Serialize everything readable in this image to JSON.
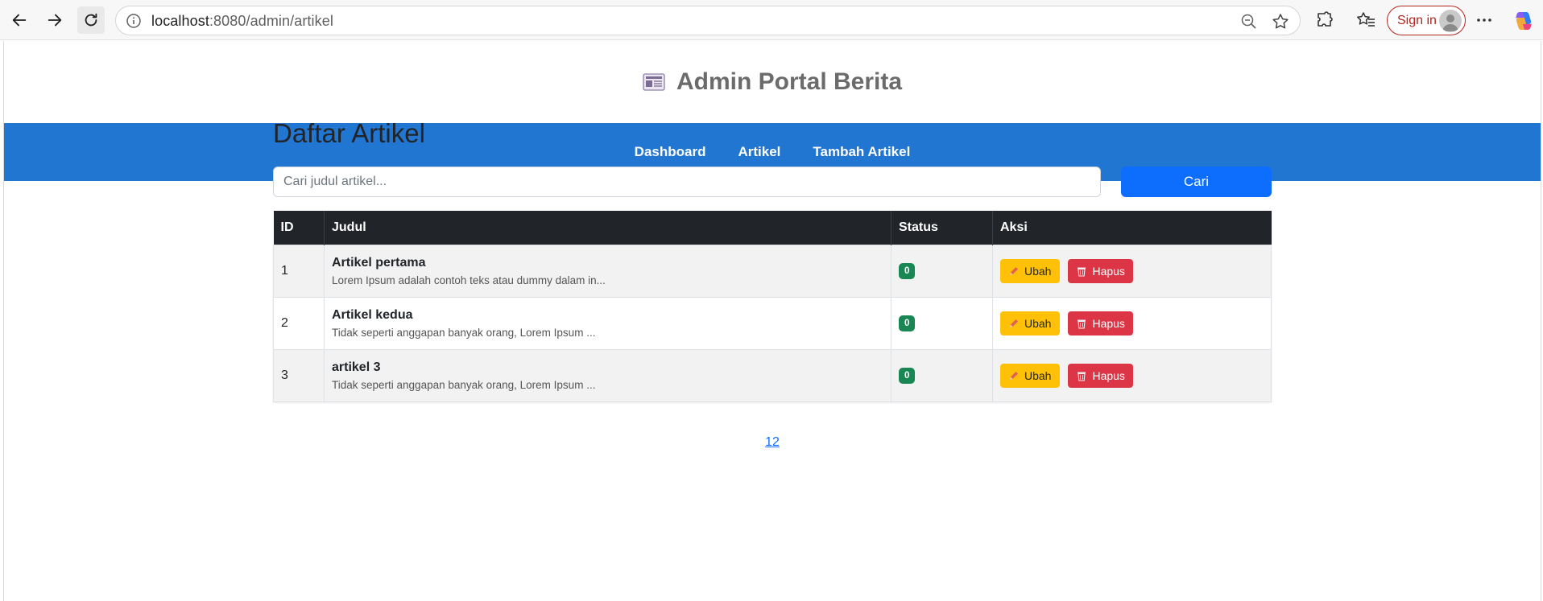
{
  "browser": {
    "url_host": "localhost",
    "url_rest": ":8080/admin/artikel",
    "signin_label": "Sign in"
  },
  "site": {
    "title": "Admin Portal Berita"
  },
  "nav": {
    "items": [
      {
        "label": "Dashboard"
      },
      {
        "label": "Artikel"
      },
      {
        "label": "Tambah Artikel"
      }
    ]
  },
  "main": {
    "heading": "Daftar Artikel",
    "search_placeholder": "Cari judul artikel...",
    "search_button": "Cari",
    "columns": [
      "ID",
      "Judul",
      "Status",
      "Aksi"
    ],
    "rows": [
      {
        "id": "1",
        "title": "Artikel pertama",
        "excerpt": "Lorem Ipsum adalah contoh teks atau dummy dalam in...",
        "status": "0",
        "edit": "Ubah",
        "delete": "Hapus"
      },
      {
        "id": "2",
        "title": "Artikel kedua",
        "excerpt": "Tidak seperti anggapan banyak orang, Lorem Ipsum ...",
        "status": "0",
        "edit": "Ubah",
        "delete": "Hapus"
      },
      {
        "id": "3",
        "title": "artikel 3",
        "excerpt": "Tidak seperti anggapan banyak orang, Lorem Ipsum ...",
        "status": "0",
        "edit": "Ubah",
        "delete": "Hapus"
      }
    ],
    "pagination": "12"
  },
  "colors": {
    "navbar": "#2176d2",
    "primary": "#0d6efd",
    "warning": "#ffc107",
    "danger": "#dc3545",
    "success": "#198754",
    "table_header": "#212529"
  },
  "icons": {
    "back": "arrow-left-icon",
    "forward": "arrow-right-icon",
    "refresh": "refresh-icon",
    "info": "info-icon",
    "zoom": "zoom-out-icon",
    "favorite": "star-icon",
    "extensions": "puzzle-icon",
    "favorites_bar": "favorites-icon",
    "more": "more-icon",
    "copilot": "copilot-icon",
    "site_logo": "newspaper-icon",
    "edit": "pencil-icon",
    "delete": "trash-icon"
  }
}
